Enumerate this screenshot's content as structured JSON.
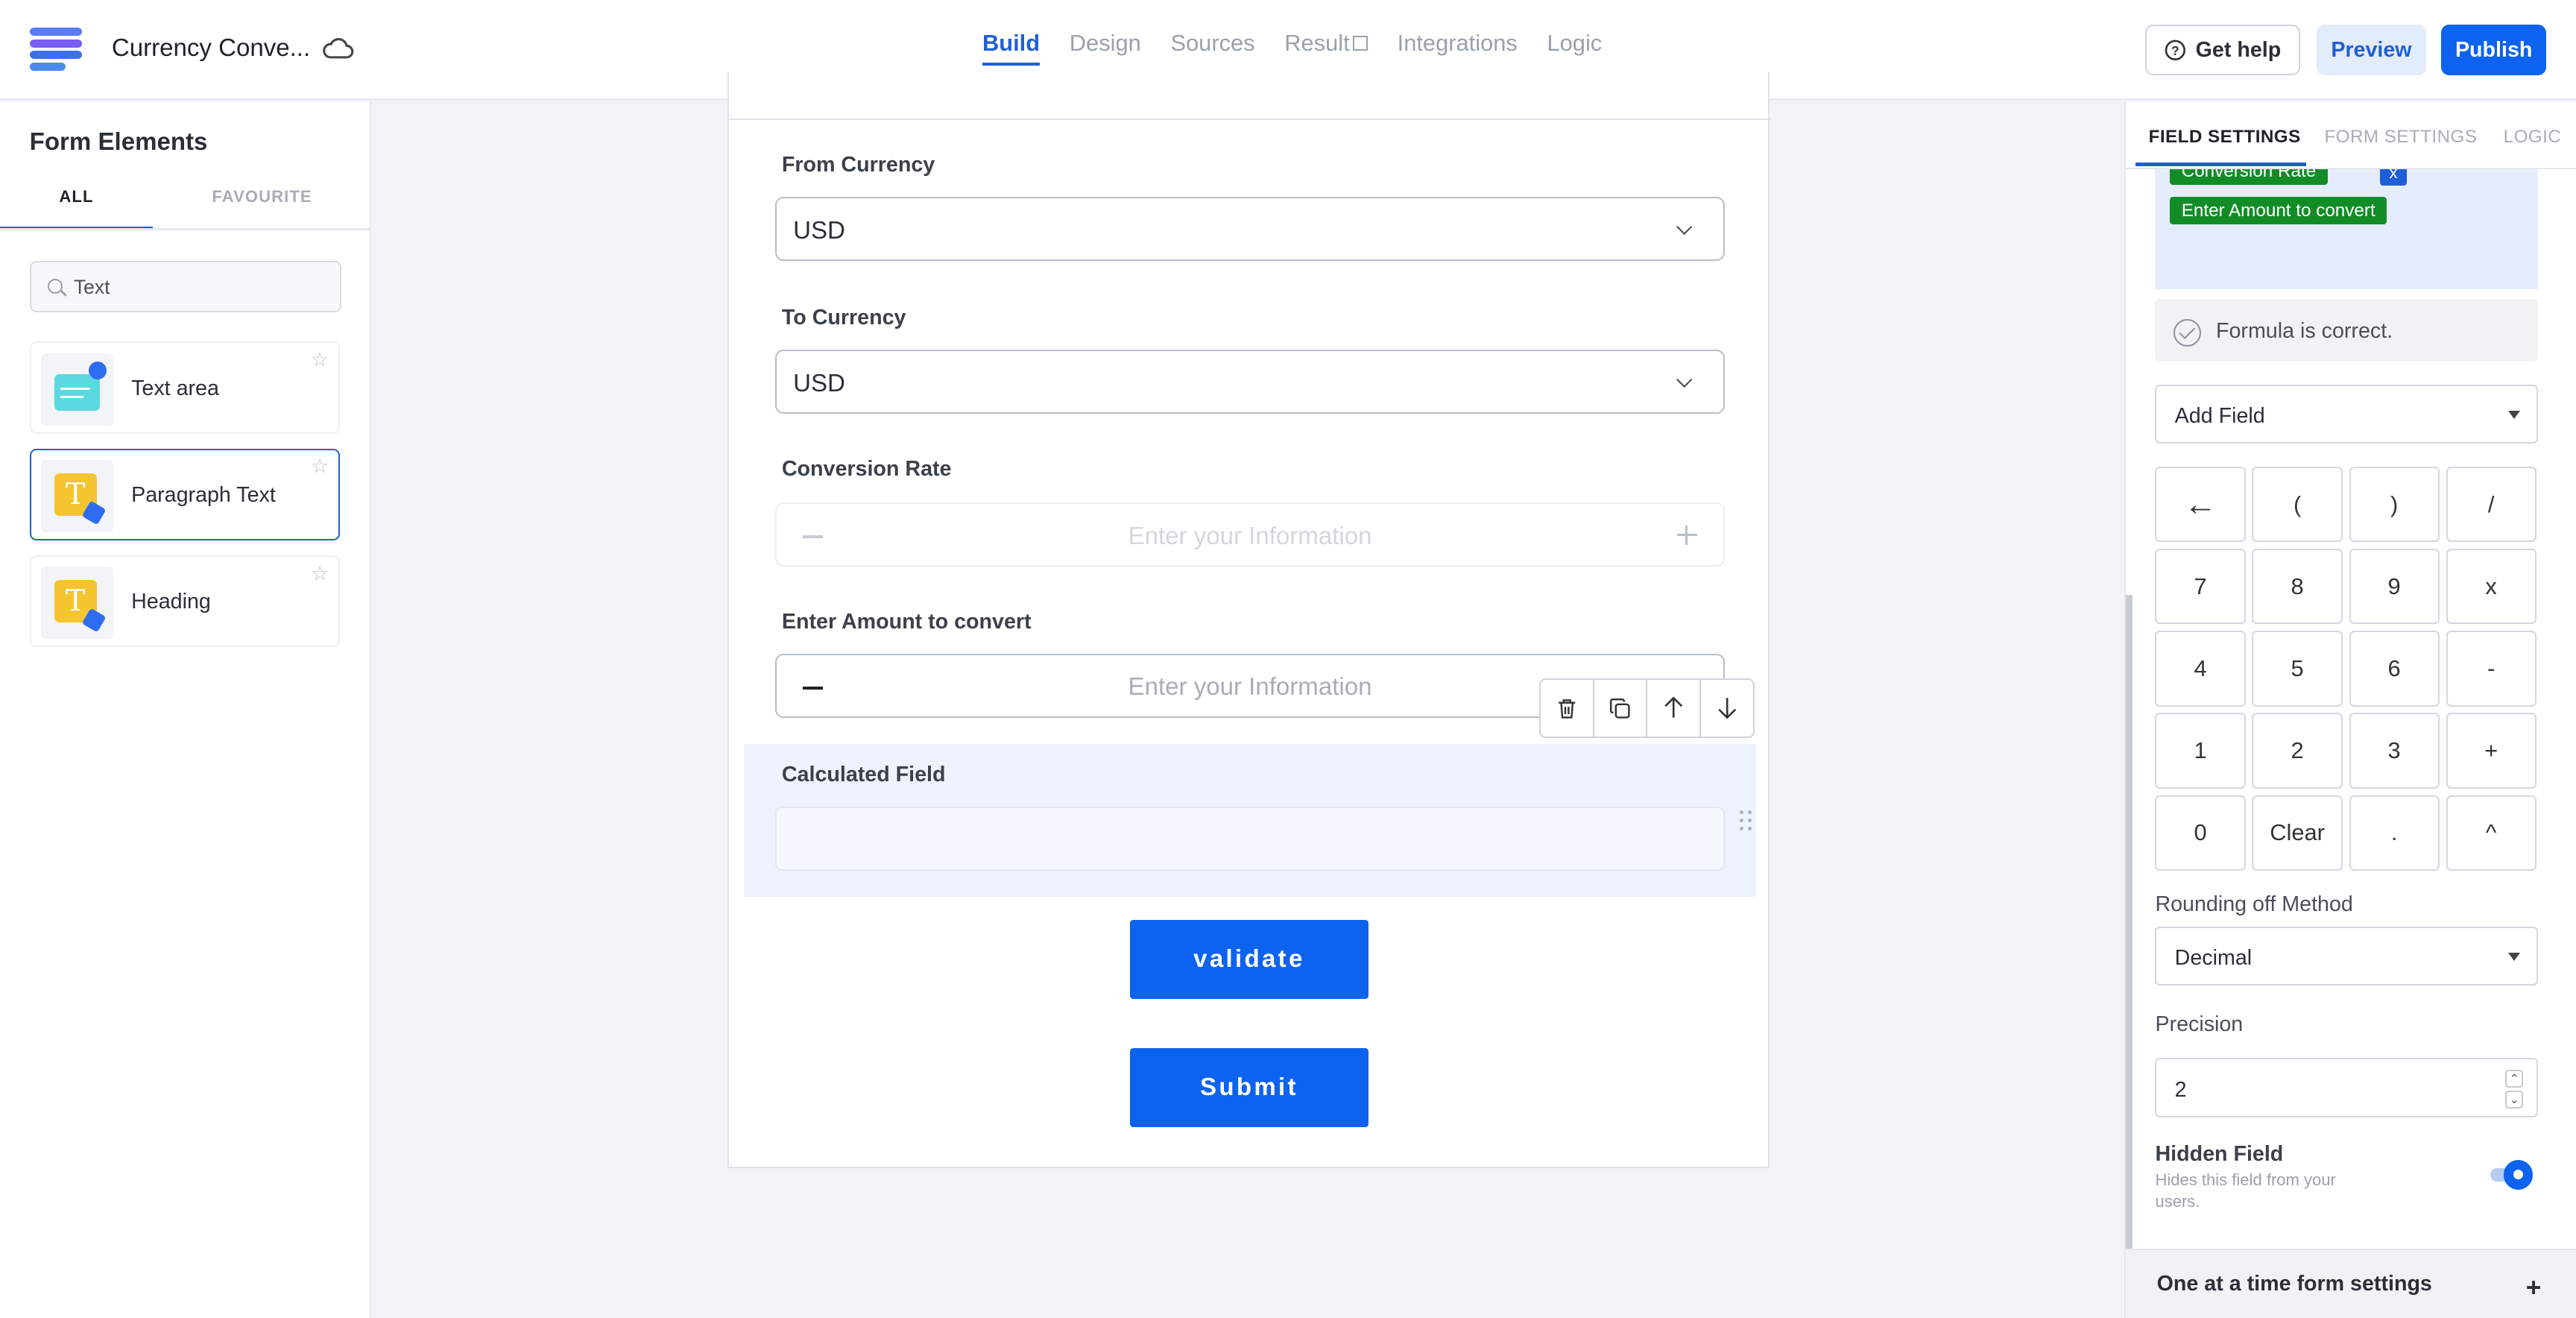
{
  "header": {
    "title": "Currency Conve...",
    "nav": [
      "Build",
      "Design",
      "Sources",
      "Result",
      "Integrations",
      "Logic"
    ],
    "active_nav": "Build",
    "help_label": "Get help",
    "preview_label": "Preview",
    "publish_label": "Publish"
  },
  "left_panel": {
    "title": "Form Elements",
    "tabs": [
      "ALL",
      "FAVOURITE"
    ],
    "search_value": "Text",
    "elements": [
      "Text area",
      "Paragraph Text",
      "Heading"
    ]
  },
  "form": {
    "fields": {
      "from_currency": {
        "label": "From Currency",
        "value": "USD"
      },
      "to_currency": {
        "label": "To Currency",
        "value": "USD"
      },
      "conversion_rate": {
        "label": "Conversion Rate",
        "placeholder": "Enter your Information"
      },
      "amount": {
        "label": "Enter Amount to convert",
        "placeholder": "Enter your Information"
      },
      "calculated": {
        "label": "Calculated Field"
      }
    },
    "validate_label": "validate",
    "submit_label": "Submit"
  },
  "right_panel": {
    "tabs": [
      "FIELD SETTINGS",
      "FORM SETTINGS",
      "LOGIC"
    ],
    "formula_tokens": [
      "Conversion Rate",
      "x",
      "Enter Amount to convert"
    ],
    "formula_status": "Formula is correct.",
    "add_field_label": "Add Field",
    "keypad": [
      "←",
      "(",
      ")",
      "/",
      "7",
      "8",
      "9",
      "x",
      "4",
      "5",
      "6",
      "-",
      "1",
      "2",
      "3",
      "+",
      "0",
      "Clear",
      ".",
      "^"
    ],
    "rounding_label": "Rounding off Method",
    "rounding_value": "Decimal",
    "precision_label": "Precision",
    "precision_value": "2",
    "hidden_field_title": "Hidden Field",
    "hidden_field_desc": "Hides this field from your users.",
    "hidden_field_on": true,
    "one_at_a_time_label": "One at a time form settings"
  },
  "colors": {
    "primary": "#0d63f0",
    "chip_green": "#138c28",
    "calc_bg": "#edf2fd"
  }
}
